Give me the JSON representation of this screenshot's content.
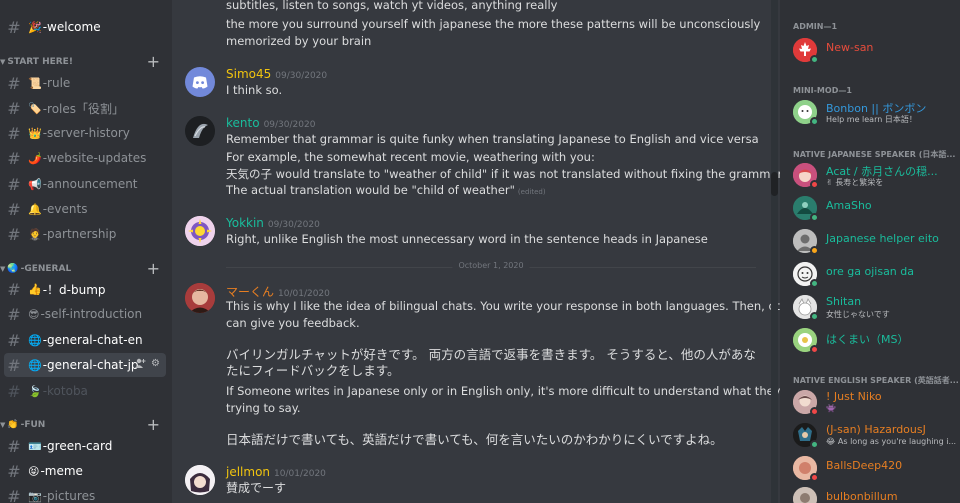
{
  "sidebar": {
    "top_channels": [
      {
        "emoji": "🎉",
        "name": "-welcome"
      }
    ],
    "categories": [
      {
        "name": "START HERE!",
        "channels": [
          {
            "emoji": "📜",
            "name": "-rule"
          },
          {
            "emoji": "🏷️",
            "name": "-roles「役割」"
          },
          {
            "emoji": "👑",
            "name": "-server-history"
          },
          {
            "emoji": "🌶️",
            "name": "-website-updates"
          },
          {
            "emoji": "📢",
            "name": "-announcement"
          },
          {
            "emoji": "🔔",
            "name": "-events"
          },
          {
            "emoji": "🤵",
            "name": "-partnership"
          }
        ]
      },
      {
        "name": "-GENERAL",
        "icon": "🌏",
        "channels": [
          {
            "emoji": "👍",
            "name": "-！d-bump"
          },
          {
            "emoji": "😎",
            "name": "-self-introduction"
          },
          {
            "emoji": "🌐",
            "name": "-general-chat-en"
          },
          {
            "emoji": "🌐",
            "name": "-general-chat-jp"
          },
          {
            "emoji": "🍃",
            "name": "-kotoba"
          }
        ]
      },
      {
        "name": "-FUN",
        "icon": "👏",
        "channels": [
          {
            "emoji": "🪪",
            "name": "-green-card"
          },
          {
            "emoji": "😝",
            "name": "-meme"
          },
          {
            "emoji": "📷",
            "name": "-pictures"
          }
        ]
      }
    ]
  },
  "chat": {
    "top_lines": [
      "subtitles, listen to songs, watch yt videos, anything really",
      "the more you surround yourself with japanese the more these patterns will be unconsciously",
      "memorized by your brain"
    ],
    "messages": [
      {
        "author": "Simo45",
        "color": "#f1c40f",
        "timestamp": "09/30/2020",
        "lines": [
          "I think so."
        ]
      },
      {
        "author": "kento",
        "color": "#1abc9c",
        "timestamp": "09/30/2020",
        "lines": [
          "Remember that grammar is quite funky when translating Japanese to English and vice versa",
          "For example, the somewhat recent movie, weathering with you:",
          "天気の子 would translate to \"weather of child\" if it was not translated without fixing the grammar.",
          "The actual translation would be \"child of weather\""
        ],
        "edited": "(edited)"
      },
      {
        "author": "Yokkin",
        "color": "#1abc9c",
        "timestamp": "09/30/2020",
        "lines": [
          "Right, unlike English the most unnecessary word in the sentence heads in Japanese"
        ]
      },
      {
        "author": "マーくん",
        "color": "#e67e22",
        "timestamp": "10/01/2020",
        "lines": [
          "This is why I like the idea of bilingual chats. You write your response in both languages. Then, others",
          "can give you feedback.",
          "バイリンガルチャットが好きです。 両方の言語で返事を書きます。 そうすると、他の人があな",
          "たにフィードバックをします。",
          "If Someone writes in Japanese only or  in English only, it's more difficult to understand what they are",
          "trying to say.",
          "日本語だけで書いても、英語だけで書いても、何を言いたいのかわかりにくいですよね。"
        ]
      },
      {
        "author": "jellmon",
        "color": "#f1c40f",
        "timestamp": "10/01/2020",
        "lines": [
          "賛成でーす"
        ]
      }
    ],
    "date_divider": "October 1, 2020"
  },
  "members": {
    "groups": [
      {
        "label": "ADMIN—1",
        "members": [
          {
            "name": "New-san",
            "color": "#e74c3c",
            "status_text": "",
            "presence": "online"
          }
        ]
      },
      {
        "label": "MINI-MOD—1",
        "members": [
          {
            "name": "Bonbon || ボンボン",
            "color": "#3498db",
            "status_text": "Help me learn 日本語！",
            "presence": "online"
          }
        ]
      },
      {
        "label": "NATIVE JAPANESE SPEAKER (日本語...",
        "members": [
          {
            "name": "Acat / 赤月さんの穏...",
            "color": "#1abc9c",
            "status_text": "✌ 長寿と繁栄を",
            "presence": "dnd"
          },
          {
            "name": "AmaSho",
            "color": "#1abc9c",
            "status_text": "",
            "presence": "online"
          },
          {
            "name": "Japanese helper eito",
            "color": "#1abc9c",
            "status_text": "",
            "presence": "idle"
          },
          {
            "name": "ore ga ojisan da",
            "color": "#1abc9c",
            "status_text": "",
            "presence": "online"
          },
          {
            "name": "Shitan",
            "color": "#1abc9c",
            "status_text": "女性じゃないです",
            "presence": "online"
          },
          {
            "name": "はくまい（MS）",
            "color": "#1abc9c",
            "status_text": "",
            "presence": "dnd"
          }
        ]
      },
      {
        "label": "NATIVE ENGLISH SPEAKER (英語話者...",
        "members": [
          {
            "name": "! Just Niko",
            "color": "#e67e22",
            "status_text": "👾",
            "presence": "dnd"
          },
          {
            "name": "(J-san) HazardousJ",
            "color": "#e67e22",
            "status_text": "😂 As long as you're laughing i...",
            "presence": "online"
          },
          {
            "name": "BallsDeep420",
            "color": "#e67e22",
            "status_text": "",
            "presence": "dnd"
          },
          {
            "name": "bulbonbillum",
            "color": "#e67e22",
            "status_text": "",
            "presence": "online"
          }
        ]
      }
    ]
  }
}
